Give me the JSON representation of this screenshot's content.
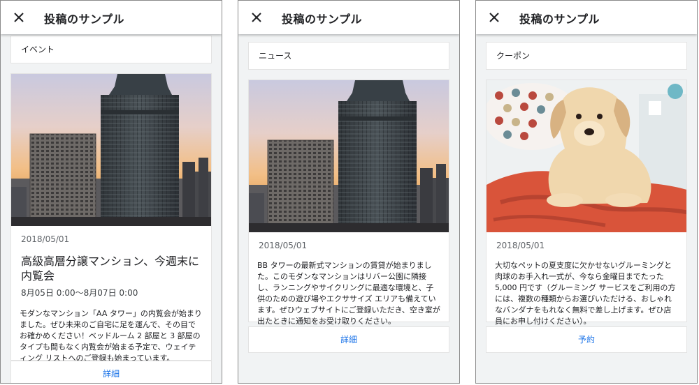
{
  "panels": [
    {
      "header_title": "投稿のサンプル",
      "post_type": "イベント",
      "date": "2018/05/01",
      "title": "高級高層分譲マンション、今週末に内覧会",
      "event_period": "8月05日 0:00～8月07日 0:00",
      "body": "モダンなマンション「AA タワー」の内覧会が始まりました。ぜひ未来のご自宅に足を運んで、その目でお確かめください！ベッドルーム 2 部屋と 3 部屋のタイプも間もなく内覧会が始まる予定で、ウェイティング リストへのご登録も始まっています。",
      "action": "詳細",
      "image": "city-skyscraper-sunset"
    },
    {
      "header_title": "投稿のサンプル",
      "post_type": "ニュース",
      "date": "2018/05/01",
      "body": "BB タワーの最新式マンションの賃貸が始まりました。このモダンなマンションはリバー公園に隣接し、ランニングやサイクリングに最適な環境と、子供のための遊び場やエクササイズ エリアも備えています。ぜひウェブサイトにご登録いただき、空き室が出たときに通知をお受け取りください。",
      "action": "詳細",
      "image": "city-skyscraper-sunset"
    },
    {
      "header_title": "投稿のサンプル",
      "post_type": "クーポン",
      "date": "2018/05/01",
      "body": "大切なペットの夏支度に欠かせないグルーミングと肉球のお手入れ一式が、今なら金曜日までたった 5,000 円です（グルーミング サービスをご利用の方には、複数の種類からお選びいただける、おしゃれなバンダナをもれなく無料で差し上げます。ぜひ店員にお申し付けください）。",
      "action": "予約",
      "image": "puppy-on-orange-blanket"
    }
  ],
  "icons": {
    "close": "close-icon"
  },
  "colors": {
    "action_link": "#1a73e8",
    "panel_bg": "#f1f3f4",
    "card_bg": "#ffffff"
  }
}
